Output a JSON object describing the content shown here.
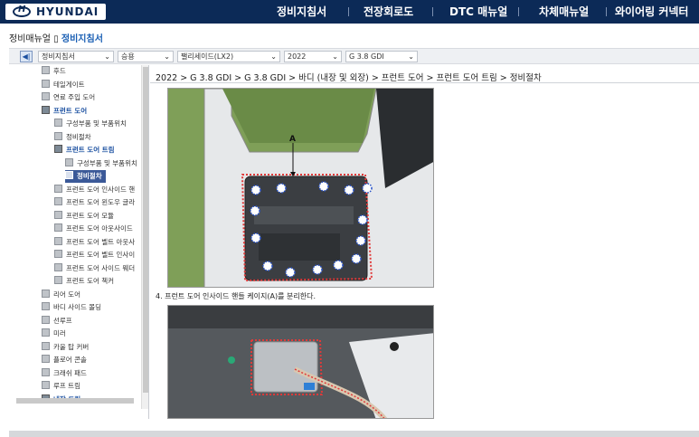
{
  "header": {
    "brand": "HYUNDAI",
    "nav": [
      {
        "label": "정비지침서"
      },
      {
        "label": "전장회로도"
      },
      {
        "label": "DTC 매뉴얼"
      },
      {
        "label": "차체매뉴얼"
      },
      {
        "label": "와이어링 커넥터"
      }
    ]
  },
  "breadcrumb_top": {
    "root": "정비매뉴얼",
    "sep": "▯",
    "current": "정비지침서"
  },
  "filters": {
    "collapse": "◀|",
    "selects": [
      {
        "value": "정비지침서"
      },
      {
        "value": "승용"
      },
      {
        "value": "팰리세이드(LX2)"
      },
      {
        "value": "2022"
      },
      {
        "value": "G 3.8 GDI"
      }
    ]
  },
  "tree": [
    {
      "label": "후드",
      "level": 1
    },
    {
      "label": "테일게이트",
      "level": 1
    },
    {
      "label": "연료 주입 도어",
      "level": 1
    },
    {
      "label": "프런트 도어",
      "level": 1,
      "state": "open"
    },
    {
      "label": "구성부품 및 부품위치",
      "level": 2
    },
    {
      "label": "정비절차",
      "level": 2
    },
    {
      "label": "프런트 도어 트림",
      "level": 2,
      "state": "open"
    },
    {
      "label": "구성부품 및 부품위치",
      "level": 3
    },
    {
      "label": "정비절차",
      "level": 3,
      "state": "selected"
    },
    {
      "label": "프런트 도어 인사이드 핸",
      "level": 2
    },
    {
      "label": "프런트 도어 윈도우 글라",
      "level": 2
    },
    {
      "label": "프런트 도어 모듈",
      "level": 2
    },
    {
      "label": "프런트 도어 아웃사이드",
      "level": 2
    },
    {
      "label": "프런트 도어 벨트 아웃사",
      "level": 2
    },
    {
      "label": "프런트 도어 벨트 인사이",
      "level": 2
    },
    {
      "label": "프런트 도어 사이드 웨더",
      "level": 2
    },
    {
      "label": "프런트 도어 첵커",
      "level": 2
    },
    {
      "label": "리어 도어",
      "level": 1
    },
    {
      "label": "바디 사이드 몰딩",
      "level": 1
    },
    {
      "label": "선루프",
      "level": 1
    },
    {
      "label": "미러",
      "level": 1
    },
    {
      "label": "카울 탑 커버",
      "level": 1
    },
    {
      "label": "플로어 콘솔",
      "level": 1
    },
    {
      "label": "크래쉬 패드",
      "level": 1
    },
    {
      "label": "루프 트림",
      "level": 1
    },
    {
      "label": "내장 트림",
      "level": 1,
      "state": "open"
    }
  ],
  "content": {
    "path": "2022 > G 3.8 GDI > G 3.8 GDI > 바디 (내장 및 외장) > 프런트 도어 > 프런트 도어 트림 > 정비절차",
    "figure1_callout": "A",
    "step4": "4. 프런트 도어 인사이드 핸들 케이지(A)를 분리한다."
  },
  "colors": {
    "header_bg": "#0c2a57",
    "selected_bg": "#3b5998",
    "link": "#1a5fb4"
  }
}
